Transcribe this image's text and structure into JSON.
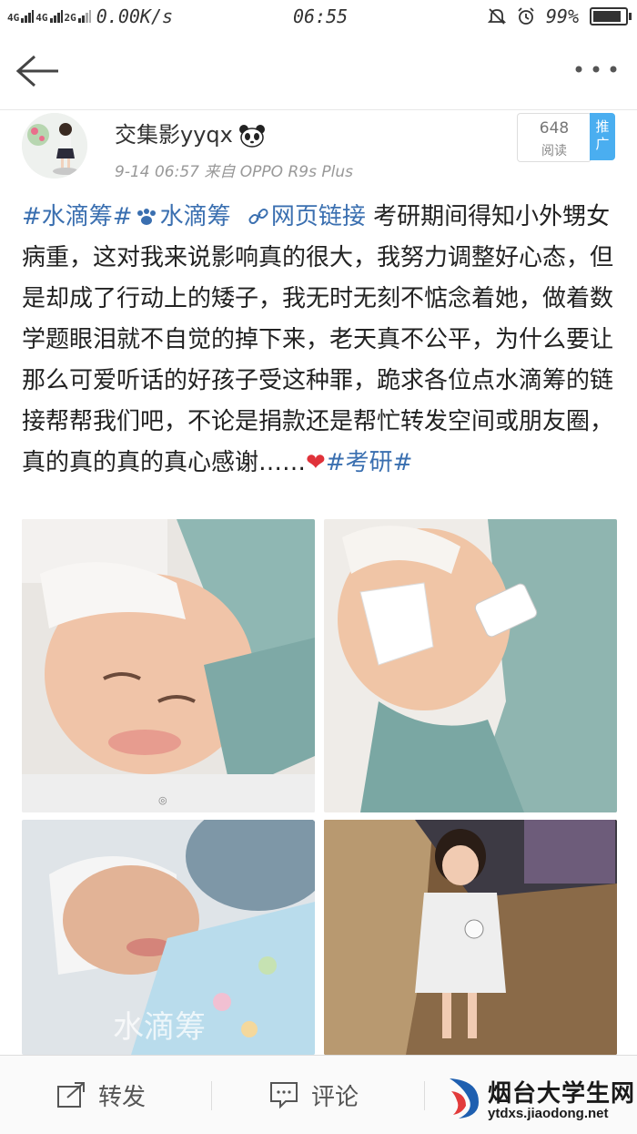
{
  "status_bar": {
    "signal_1": "4G",
    "signal_2": "4G",
    "signal_3": "2G",
    "speed": "0.00K/s",
    "time": "06:55",
    "battery": "99%",
    "battery_level": 0.99
  },
  "post": {
    "username": "交集影yyqx",
    "meta": "9-14 06:57  来自 OPPO R9s Plus",
    "read_count": "648",
    "read_label": "阅读",
    "promote_label": "推广",
    "body": {
      "tag1": "#水滴筹#",
      "tag2": "水滴筹",
      "link": "网页链接",
      "text": " 考研期间得知小外甥女病重，这对我来说影响真的很大，我努力调整好心态，但是却成了行动上的矮子，我无时无刻不惦念着她，做着数学题眼泪就不自觉的掉下来，老天真不公平，为什么要让那么可爱听话的好孩子受这种罪，跪求各位点水滴筹的链接帮帮我们吧，不论是捐款还是帮忙转发空间或朋友圈，真的真的真的真心感谢……",
      "tag3": "#考研#"
    },
    "watermark": "水滴筹"
  },
  "bottom_bar": {
    "forward_label": "转发",
    "comment_label": "评论"
  },
  "site_logo": {
    "name": "烟台大学生网",
    "url": "ytdxs.jiaodong.net"
  },
  "icons": [
    "back-arrow-icon",
    "more-icon",
    "panda-icon",
    "heart-icon",
    "forward-icon",
    "comment-icon",
    "link-icon"
  ],
  "colors": {
    "link": "#3a6fb0",
    "promote_bg": "#4aaef0",
    "heart": "#e0323a"
  }
}
